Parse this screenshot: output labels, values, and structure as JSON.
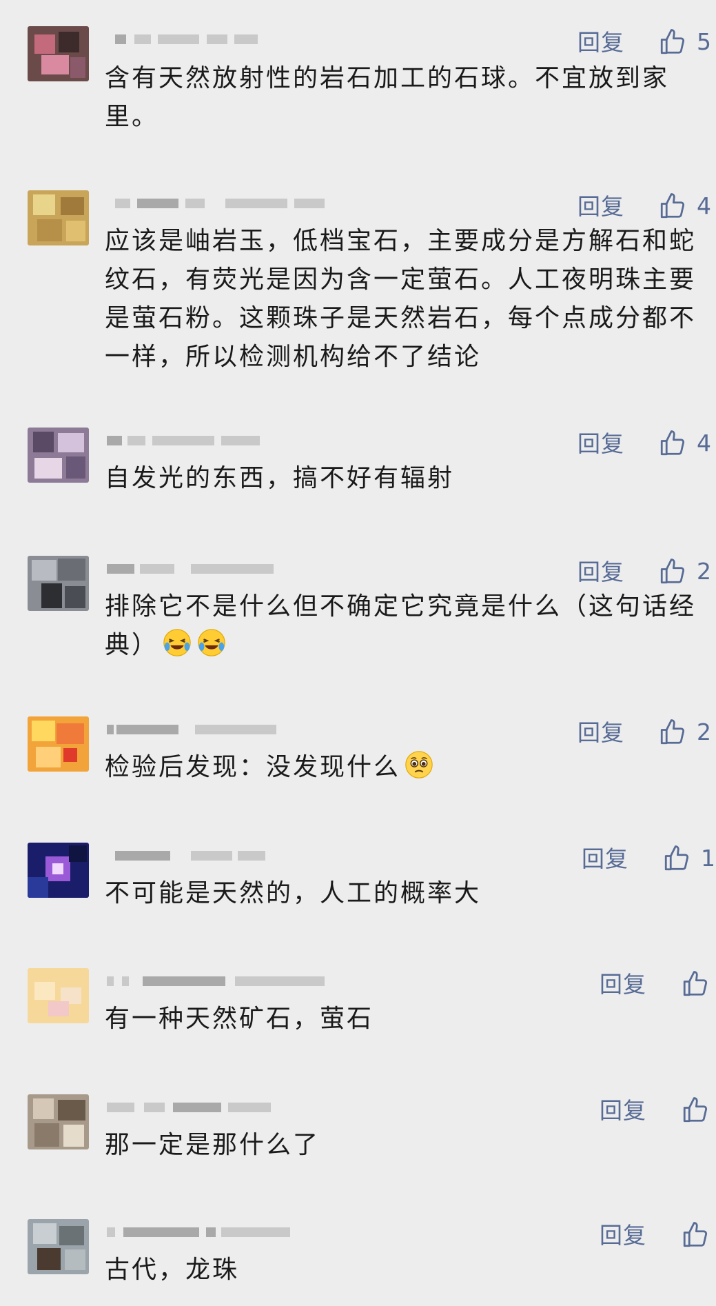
{
  "reply_label": "回复",
  "comments": [
    {
      "text": "含有天然放射性的岩石加工的石球。不宜放到家里。",
      "likes": "5"
    },
    {
      "text": "应该是岫岩玉，低档宝石，主要成分是方解石和蛇纹石，有荧光是因为含一定萤石。人工夜明珠主要是萤石粉。这颗珠子是天然岩石，每个点成分都不一样，所以检测机构给不了结论",
      "likes": "4"
    },
    {
      "text": "自发光的东西，搞不好有辐射",
      "likes": "4"
    },
    {
      "text": "排除它不是什么但不确定它究竟是什么（这句话经典）",
      "likes": "2",
      "emoji": [
        "crying-laughing-emoji",
        "crying-laughing-emoji"
      ]
    },
    {
      "text": "检验后发现：没发现什么",
      "likes": "2",
      "emoji": [
        "pleading-face-emoji"
      ]
    },
    {
      "text": "不可能是天然的，人工的概率大",
      "likes": "1"
    },
    {
      "text": "有一种天然矿石，萤石",
      "likes": ""
    },
    {
      "text": "那一定是那什么了",
      "likes": ""
    },
    {
      "text": "古代，龙珠",
      "likes": ""
    }
  ],
  "colors": {
    "background": "#ededed",
    "link_blue": "#576b95",
    "text": "#1a1a1a"
  }
}
